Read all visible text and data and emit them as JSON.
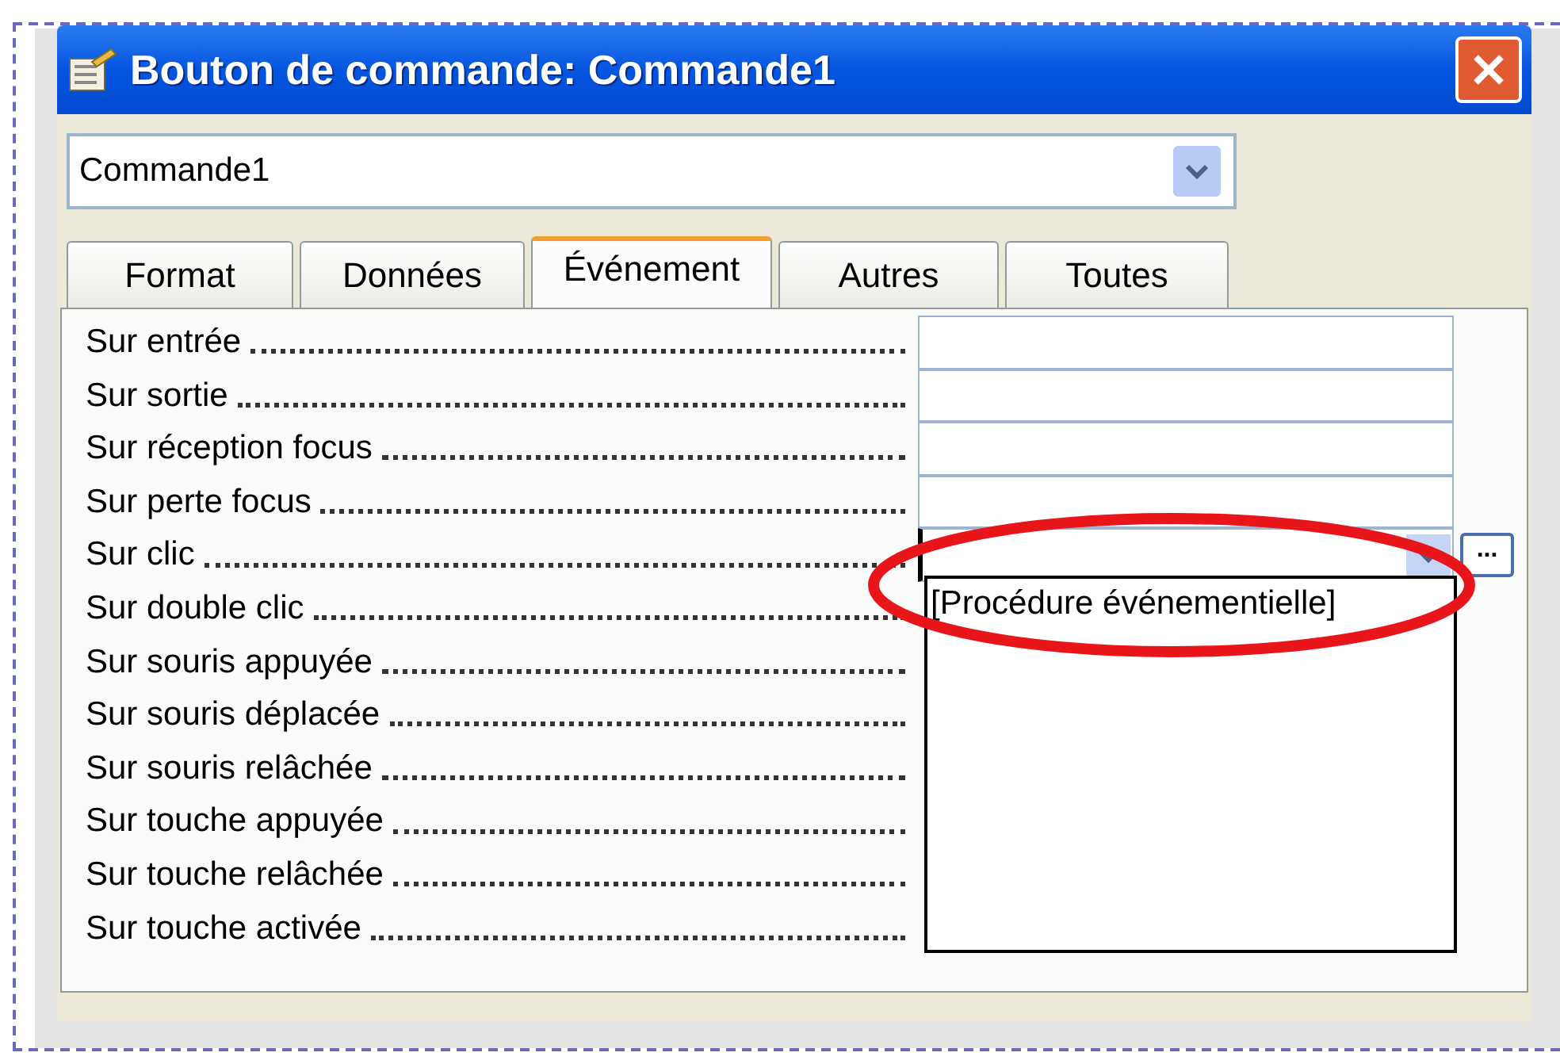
{
  "window": {
    "title": "Bouton de commande: Commande1"
  },
  "object_selector": {
    "value": "Commande1"
  },
  "tabs": [
    {
      "label": "Format",
      "selected": false
    },
    {
      "label": "Données",
      "selected": false
    },
    {
      "label": "Événement",
      "selected": true
    },
    {
      "label": "Autres",
      "selected": false
    },
    {
      "label": "Toutes",
      "selected": false
    }
  ],
  "properties": [
    {
      "label": "Sur entrée",
      "kind": "text"
    },
    {
      "label": "Sur sortie",
      "kind": "text"
    },
    {
      "label": "Sur réception focus",
      "kind": "text"
    },
    {
      "label": "Sur perte focus",
      "kind": "text"
    },
    {
      "label": "Sur clic",
      "kind": "combo",
      "builder_button": "..."
    },
    {
      "label": "Sur double clic"
    },
    {
      "label": "Sur souris appuyée"
    },
    {
      "label": "Sur souris déplacée"
    },
    {
      "label": "Sur souris relâchée"
    },
    {
      "label": "Sur touche appuyée"
    },
    {
      "label": "Sur touche relâchée"
    },
    {
      "label": "Sur touche activée"
    }
  ],
  "dropdown": {
    "items": [
      "[Procédure événementielle]"
    ]
  }
}
